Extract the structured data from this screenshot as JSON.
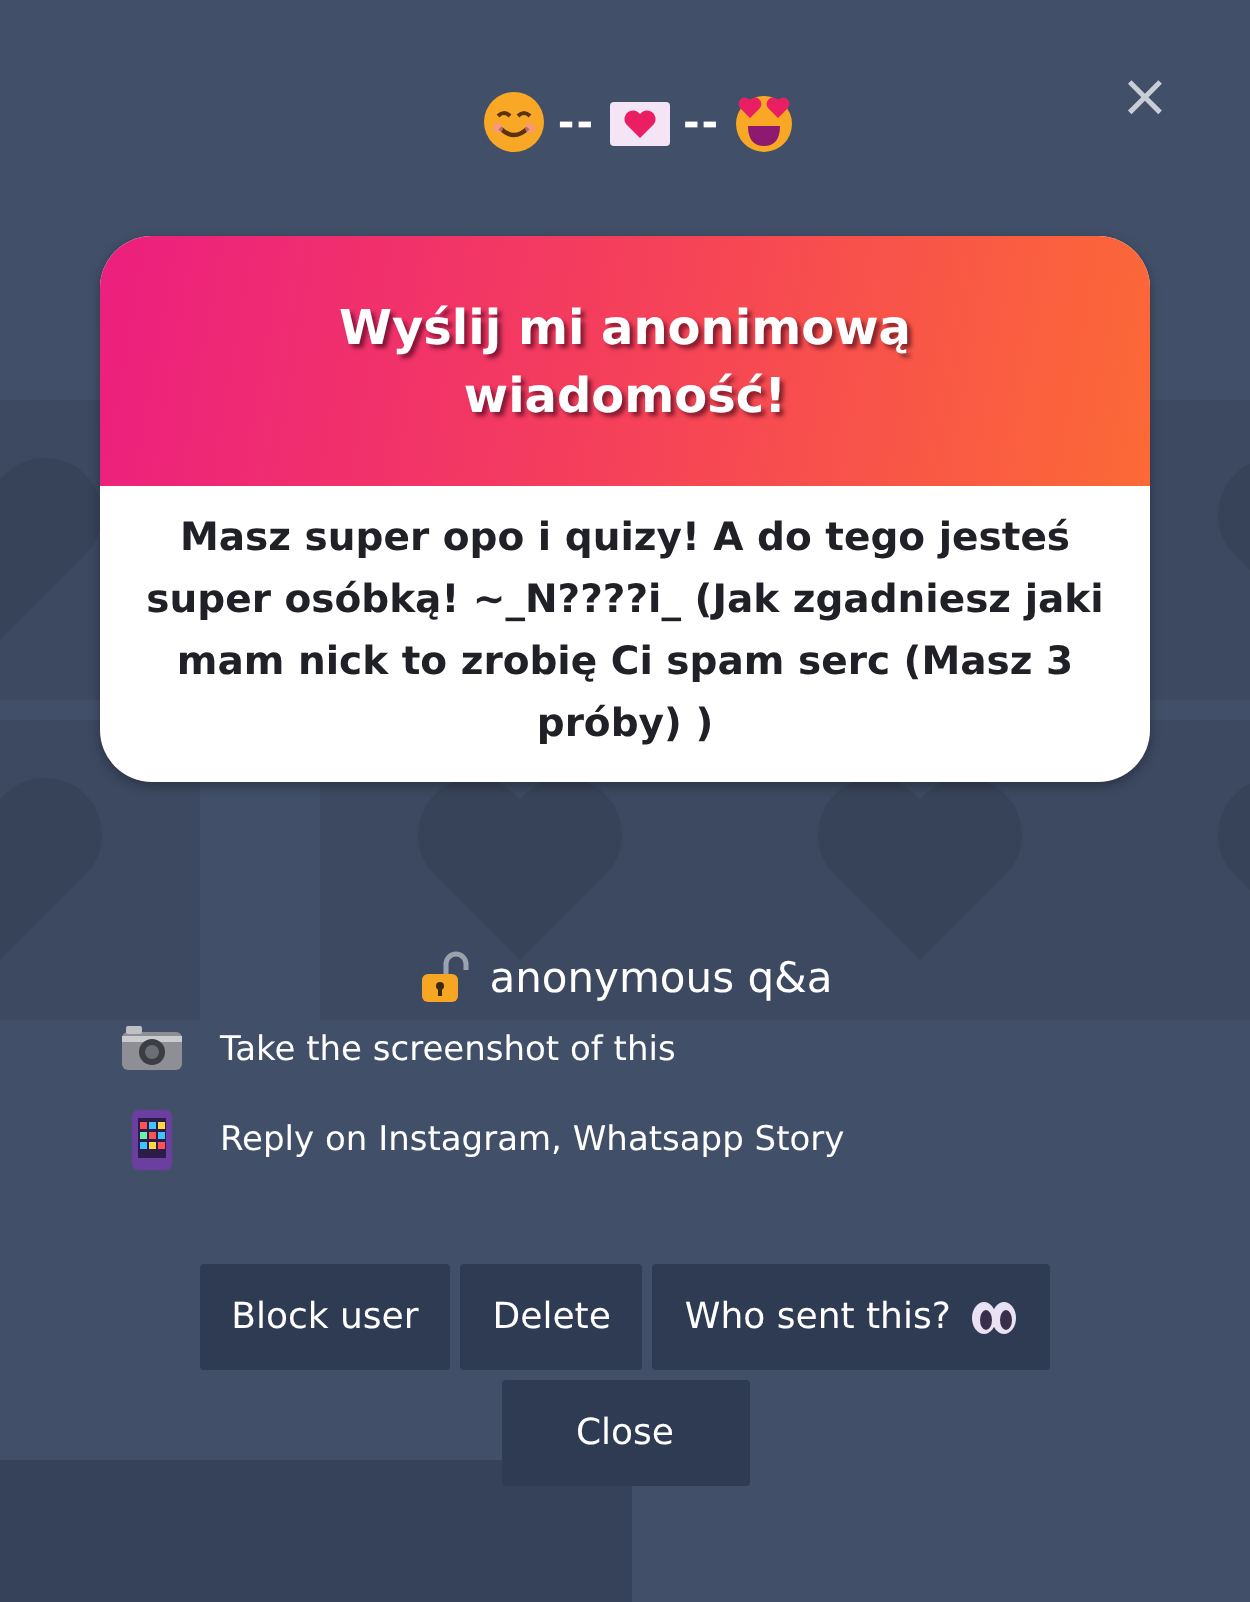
{
  "header": {
    "separators": [
      "--",
      "--"
    ]
  },
  "close_icon": "×",
  "card": {
    "title": "Wyślij mi anonimową wiadomość!",
    "message": "Masz super opo i quizy! A do tego jesteś super osóbką! ~_N????i_ (Jak zgadniesz jaki mam nick to zrobię Ci spam serc (Masz 3 próby) )"
  },
  "section_title": "anonymous q&a",
  "instructions": [
    {
      "kind": "camera",
      "text": "Take the screenshot of this"
    },
    {
      "kind": "phone",
      "text": "Reply on Instagram, Whatsapp Story"
    }
  ],
  "buttons": [
    {
      "kind": "block",
      "label": "Block user"
    },
    {
      "kind": "delete",
      "label": "Delete"
    },
    {
      "kind": "reveal",
      "label": "Who sent this?"
    }
  ],
  "close_button": "Close"
}
